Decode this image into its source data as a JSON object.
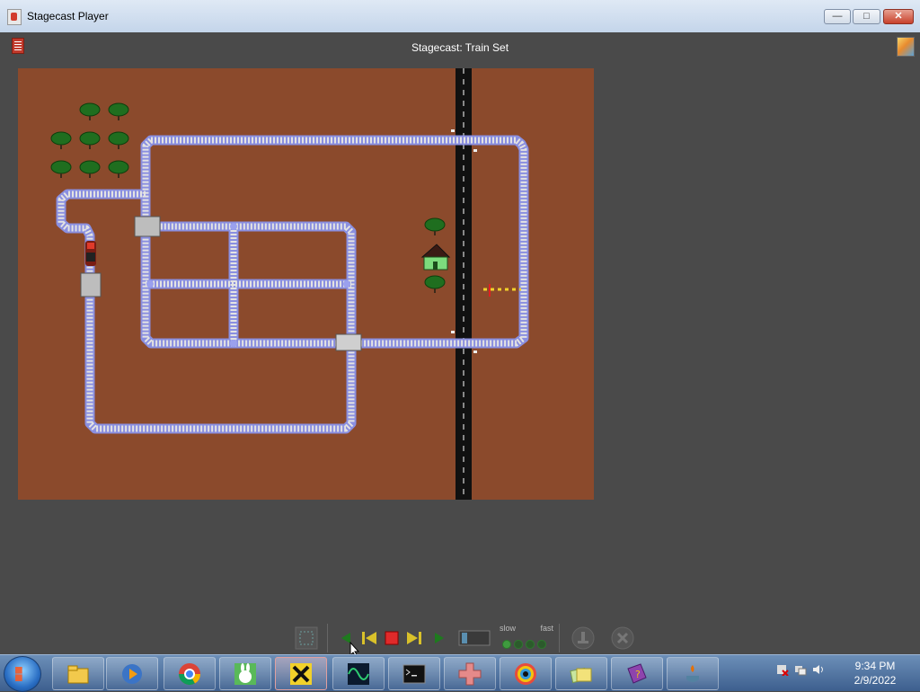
{
  "window": {
    "title": "Stagecast Player",
    "buttons": {
      "minimize": "—",
      "maximize": "□",
      "close": "✕"
    }
  },
  "player": {
    "world_title": "Stagecast: Train Set",
    "icons": {
      "rulebook": "rulebook-icon",
      "stage": "stage-icon"
    },
    "colors": {
      "ground": "#8b4a2c",
      "road": "#111111",
      "track_rail": "#8a8fe0",
      "tie": "#e0e0e0"
    }
  },
  "controls": {
    "buttons": [
      {
        "name": "back-button",
        "icon": "triangle-left"
      },
      {
        "name": "step-back-button",
        "icon": "step-back"
      },
      {
        "name": "stop-button",
        "icon": "stop-square"
      },
      {
        "name": "step-forward-button",
        "icon": "step-forward"
      },
      {
        "name": "play-button",
        "icon": "triangle-right"
      }
    ],
    "speed": {
      "slow_label": "slow",
      "fast_label": "fast"
    }
  },
  "taskbar": {
    "apps": [
      "file-explorer",
      "media-player",
      "chrome",
      "bunny-app",
      "x-app",
      "oscilloscope-app",
      "command-prompt",
      "grid-app",
      "gear-app",
      "folders-app",
      "help-book",
      "java"
    ],
    "clock": {
      "time": "9:34 PM",
      "date": "2/9/2022"
    }
  }
}
